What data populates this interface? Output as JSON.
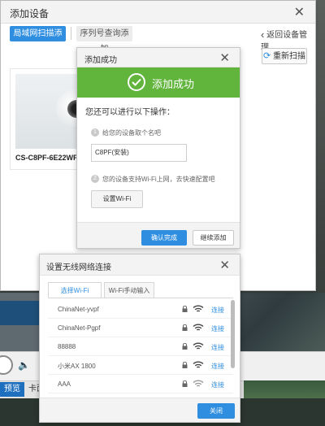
{
  "main_dialog": {
    "title": "添加设备",
    "close": "✕",
    "tab_lan": "局域网扫描添加",
    "tab_serial": "序列号查询添加",
    "back_label": "返回设备管理",
    "back_icon": "chevron-left-icon",
    "rescan_label": "重新扫描",
    "device": {
      "name": "CS-C8PF-6E22WF"
    }
  },
  "success_dialog": {
    "title": "添加成功",
    "close": "✕",
    "banner_text": "添加成功",
    "hint": "您还可以进行以下操作：",
    "step1_num": "1",
    "step1_text": "给您的设备取个名吧",
    "name_value": "C8PF(安装)",
    "step2_num": "2",
    "step2_text": "您的设备支持Wi-Fi上网，去快速配置吧",
    "set_wifi_label": "设置Wi-Fi",
    "confirm_label": "确认完成",
    "continue_label": "继续添加"
  },
  "wifi_dialog": {
    "title": "设置无线网络连接",
    "close": "✕",
    "tab_select": "选择Wi-Fi",
    "tab_manual": "Wi-Fi手动输入",
    "networks": [
      {
        "ssid": "ChinaNet-yvpf",
        "action": "连接"
      },
      {
        "ssid": "ChinaNet-Pgpf",
        "action": "连接"
      },
      {
        "ssid": "88888",
        "action": "连接"
      },
      {
        "ssid": "小米AX 1800",
        "action": "连接"
      },
      {
        "ssid": "AAA",
        "action": "连接"
      }
    ],
    "close_label": "关闭"
  },
  "background": {
    "tab_active": "预览",
    "tab_2": "卡面"
  },
  "colors": {
    "primary": "#2f8ee0",
    "success": "#61b53c"
  }
}
